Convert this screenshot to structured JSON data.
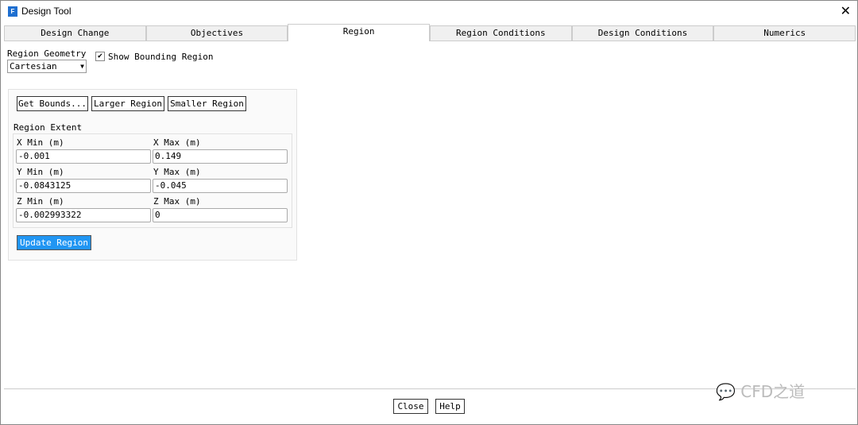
{
  "window": {
    "title": "Design Tool",
    "icon_letter": "F"
  },
  "tabs": [
    "Design Change",
    "Objectives",
    "Region",
    "Region Conditions",
    "Design Conditions",
    "Numerics"
  ],
  "region_geometry": {
    "label": "Region Geometry",
    "value": "Cartesian"
  },
  "show_bounding": {
    "label": "Show Bounding Region",
    "checked": true
  },
  "buttons": {
    "get_bounds": "Get Bounds...",
    "larger": "Larger Region",
    "smaller": "Smaller Region",
    "update": "Update Region",
    "close": "Close",
    "help": "Help"
  },
  "extent": {
    "label": "Region Extent",
    "xmin": {
      "label": "X Min (m)",
      "value": "-0.001"
    },
    "xmax": {
      "label": "X Max (m)",
      "value": "0.149"
    },
    "ymin": {
      "label": "Y Min (m)",
      "value": "-0.0843125"
    },
    "ymax": {
      "label": "Y Max (m)",
      "value": "-0.045"
    },
    "zmin": {
      "label": "Z Min (m)",
      "value": "-0.002993322"
    },
    "zmax": {
      "label": "Z Max (m)",
      "value": "0"
    }
  },
  "watermark": "CFD之道"
}
